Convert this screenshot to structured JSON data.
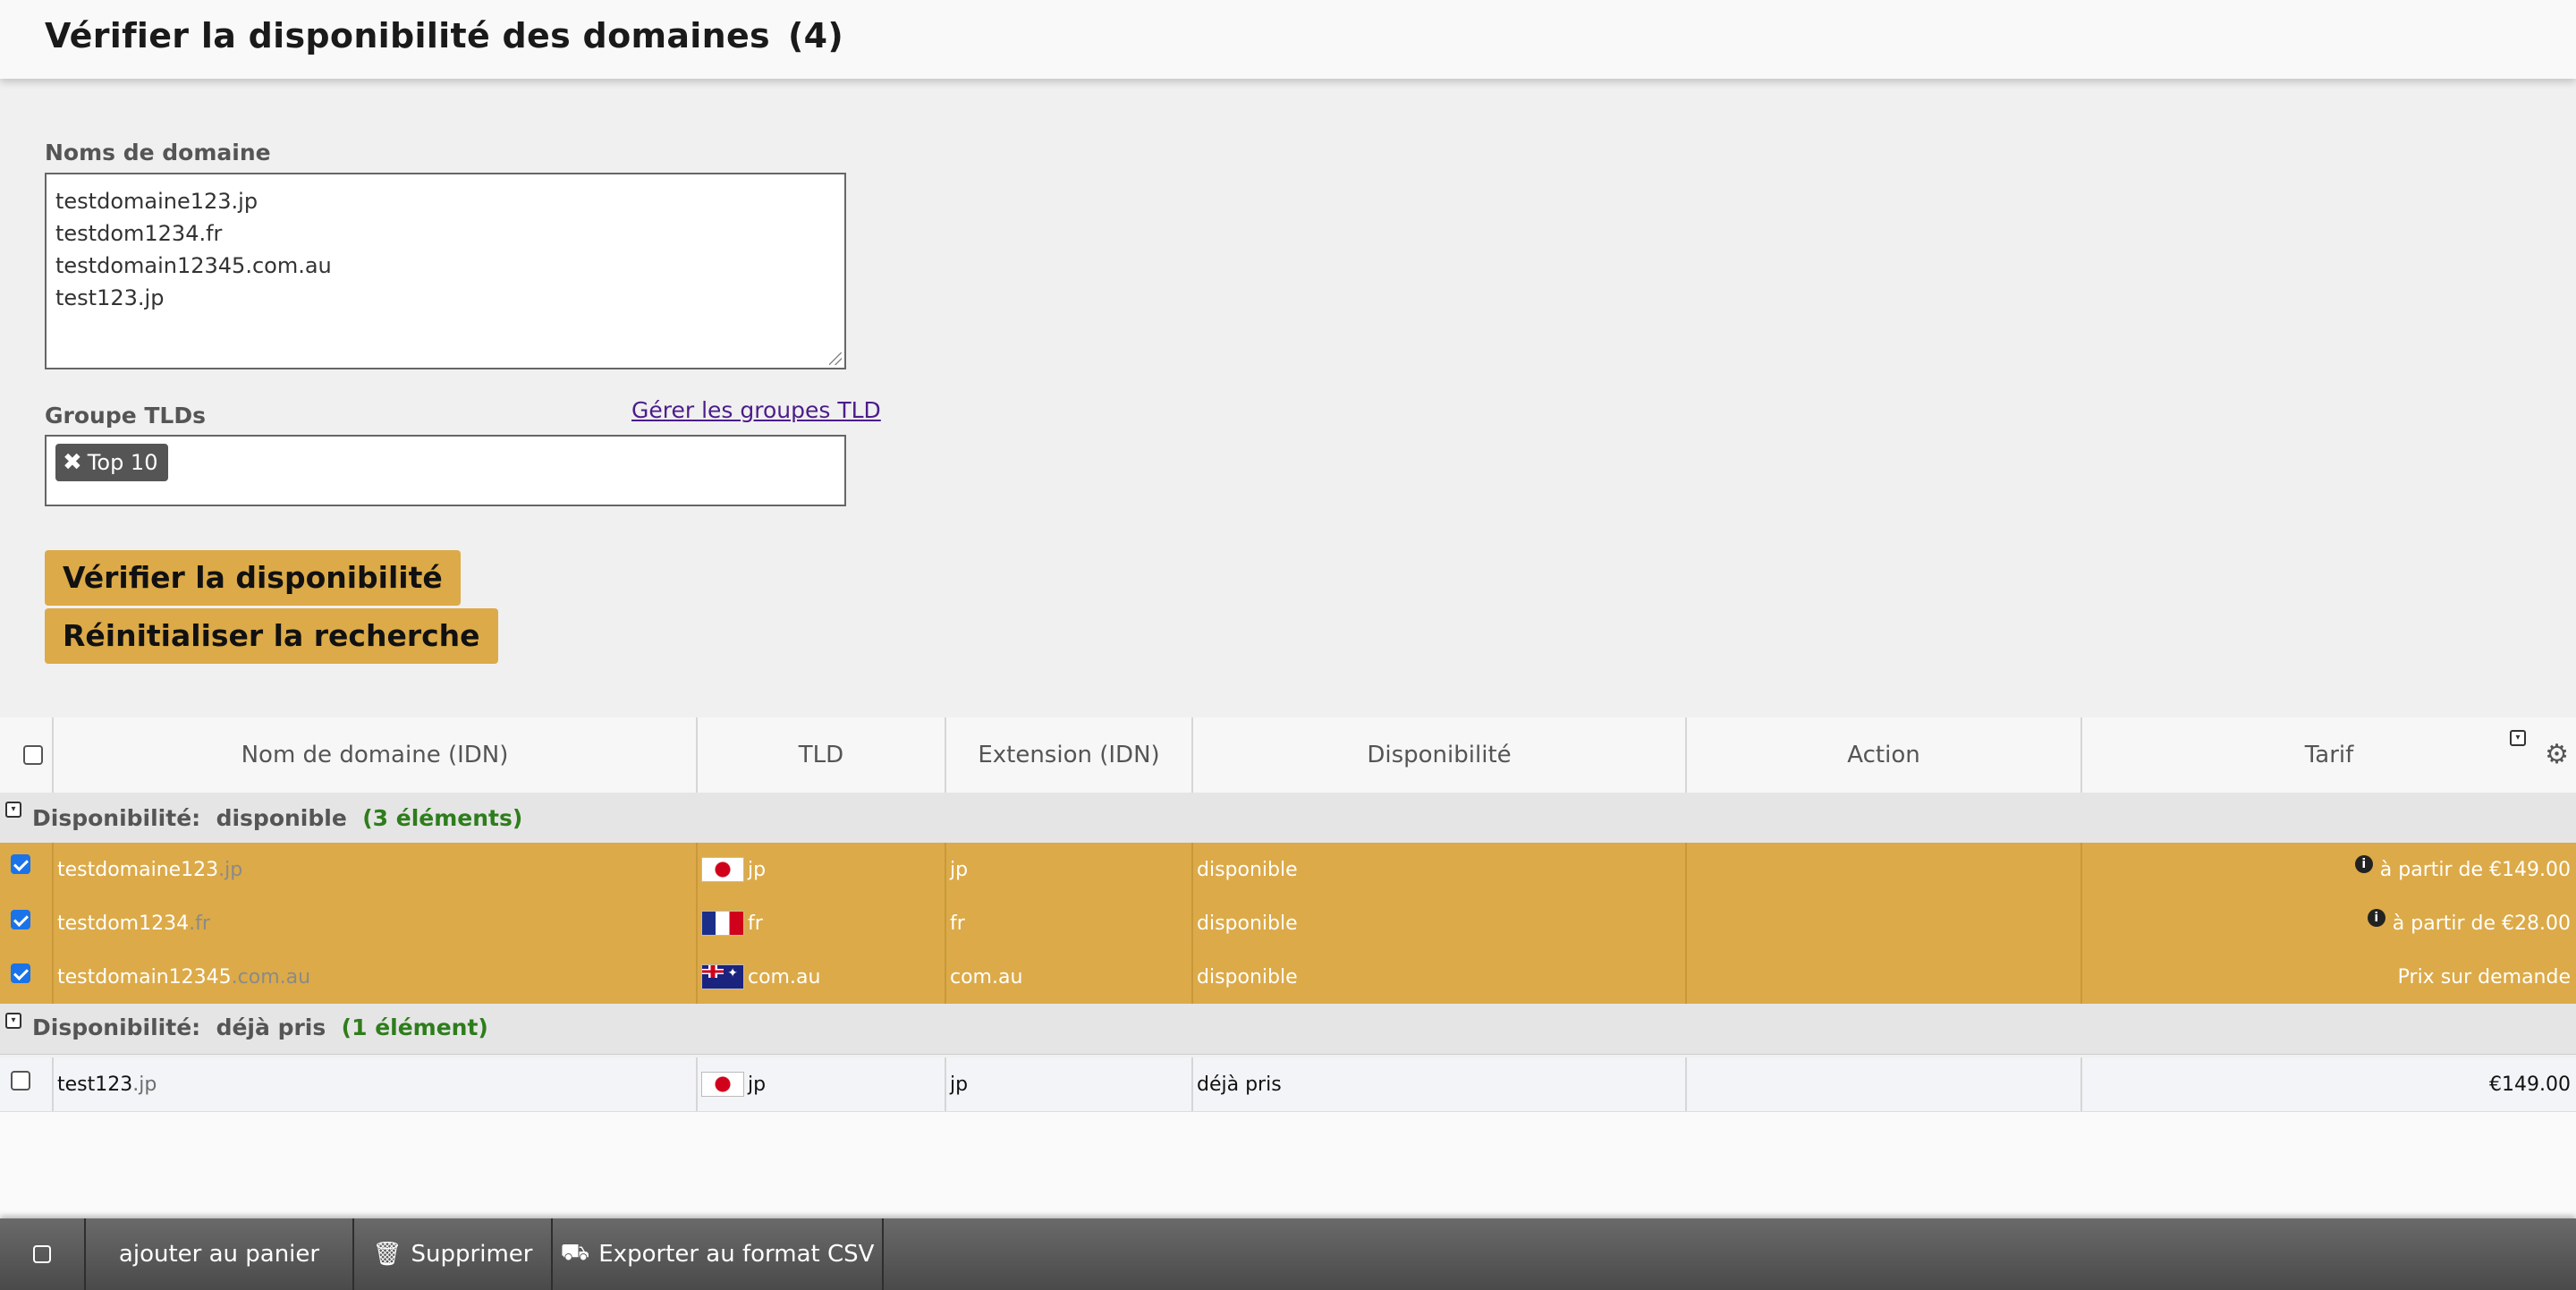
{
  "header": {
    "title": "Vérifier la disponibilité des domaines",
    "count": "(4)"
  },
  "form": {
    "domains_label": "Noms de domaine",
    "domains": [
      "testdomaine123.jp",
      "testdom1234.fr",
      "testdomain12345.com.au",
      "test123.jp"
    ],
    "tld_group_label": "Groupe TLDs",
    "manage_tld_link": "Gérer les groupes TLD",
    "tld_tags": [
      "Top 10"
    ],
    "check_button": "Vérifier la disponibilité",
    "reset_button": "Réinitialiser la recherche"
  },
  "table": {
    "columns": [
      "Nom de domaine (IDN)",
      "TLD",
      "Extension (IDN)",
      "Disponibilité",
      "Action",
      "Tarif"
    ],
    "groups": [
      {
        "label": "Disponibilité:",
        "value": "disponible",
        "count": "(3 éléments)",
        "rows": [
          {
            "checked": true,
            "name": "testdomaine123",
            "suffix": ".jp",
            "flag": "jp",
            "tld": "jp",
            "ext": "jp",
            "status": "disponible",
            "info": true,
            "price": "à partir de €149.00"
          },
          {
            "checked": true,
            "name": "testdom1234",
            "suffix": ".fr",
            "flag": "fr",
            "tld": "fr",
            "ext": "fr",
            "status": "disponible",
            "info": true,
            "price": "à partir de €28.00"
          },
          {
            "checked": true,
            "name": "testdomain12345",
            "suffix": ".com.au",
            "flag": "au",
            "tld": "com.au",
            "ext": "com.au",
            "status": "disponible",
            "info": false,
            "price": "Prix sur demande"
          }
        ]
      },
      {
        "label": "Disponibilité:",
        "value": "déjà pris",
        "count": "(1 élément)",
        "rows": [
          {
            "checked": false,
            "name": "test123",
            "suffix": ".jp",
            "flag": "jp",
            "tld": "jp",
            "ext": "jp",
            "status": "déjà pris",
            "info": false,
            "price": "€149.00"
          }
        ]
      }
    ]
  },
  "footer": {
    "add_to_cart": "ajouter au panier",
    "delete": "Supprimer",
    "export_csv": "Exporter au format CSV"
  },
  "icons": {
    "tag_remove": "close-icon",
    "collapse": "collapse-icon",
    "settings": "gear-icon",
    "info": "info-icon",
    "delete": "trash-icon",
    "export": "truck-icon"
  },
  "colors": {
    "accent": "#dcaa48",
    "available_text": "#2e7d1c",
    "footer": "#555555"
  }
}
